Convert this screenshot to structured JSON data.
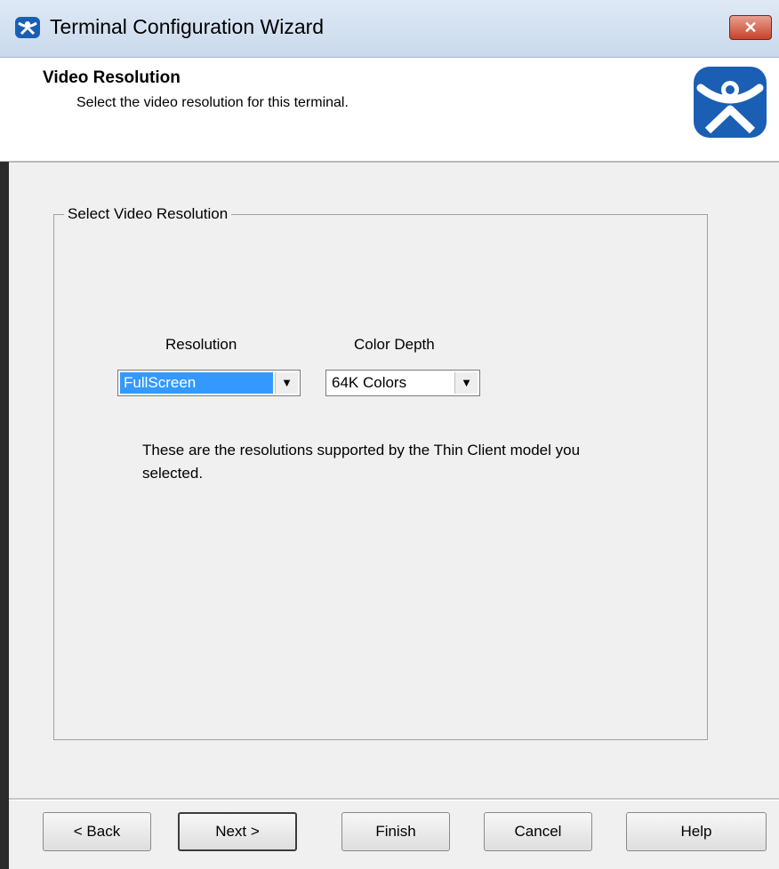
{
  "window": {
    "title": "Terminal Configuration Wizard",
    "icon": "thinmanager-icon",
    "close_label": "✕"
  },
  "header": {
    "title": "Video Resolution",
    "subtitle": "Select the video resolution for this terminal.",
    "logo": "thinmanager-logo"
  },
  "group": {
    "legend": "Select Video Resolution"
  },
  "resolution": {
    "label": "Resolution",
    "value": "FullScreen"
  },
  "color_depth": {
    "label": "Color Depth",
    "value": "64K Colors"
  },
  "description": "These are the resolutions supported by the Thin Client model you selected.",
  "buttons": {
    "back": "< Back",
    "next": "Next >",
    "finish": "Finish",
    "cancel": "Cancel",
    "help": "Help"
  },
  "colors": {
    "selection": "#3399ff",
    "logo": "#1a5fb4"
  }
}
